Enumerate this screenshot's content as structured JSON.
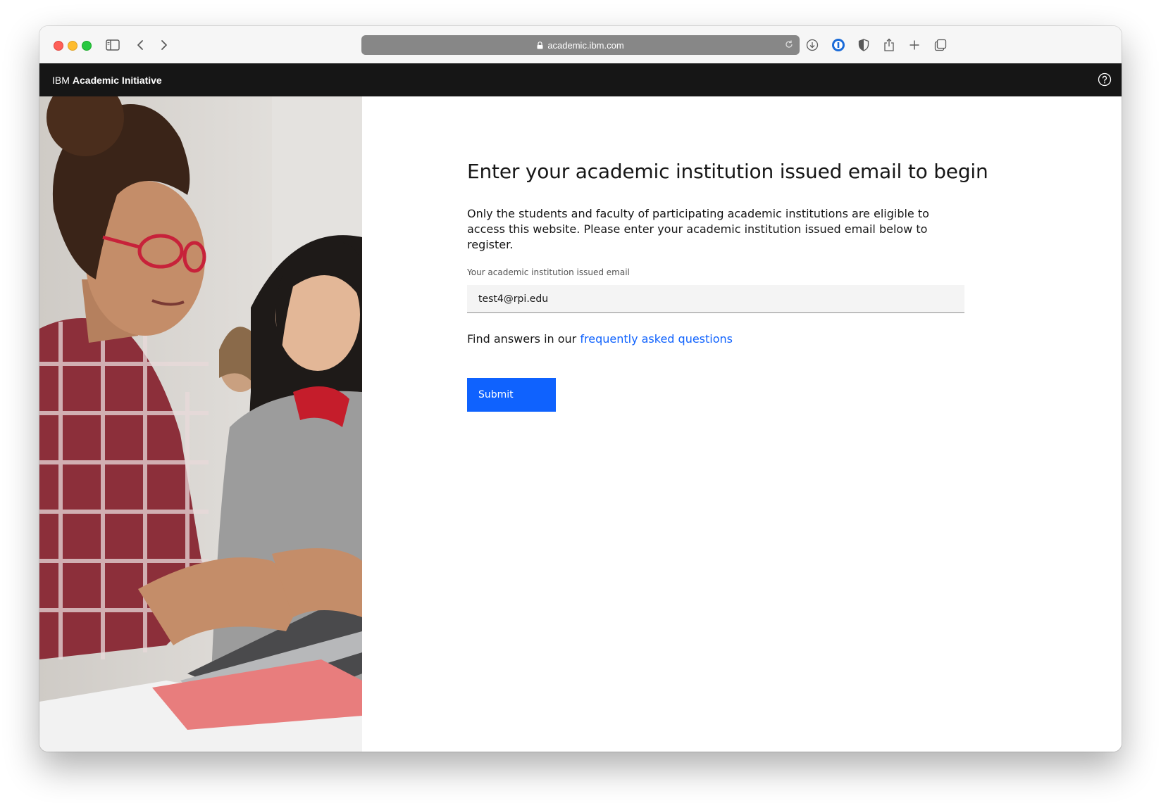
{
  "browser": {
    "url": "academic.ibm.com"
  },
  "header": {
    "brand_prefix": "IBM",
    "brand_name": "Academic Initiative"
  },
  "main": {
    "heading": "Enter your academic institution issued email to begin",
    "description": "Only the students and faculty of participating academic institutions are eligible to access this website. Please enter your academic institution issued email below to register.",
    "email_label": "Your academic institution issued email",
    "email_value": "test4@rpi.edu",
    "faq_prefix": "Find answers in our",
    "faq_link": "frequently asked questions",
    "submit_label": "Submit"
  },
  "colors": {
    "header_bg": "#161616",
    "accent": "#0f62fe",
    "address_bar": "#878787"
  }
}
